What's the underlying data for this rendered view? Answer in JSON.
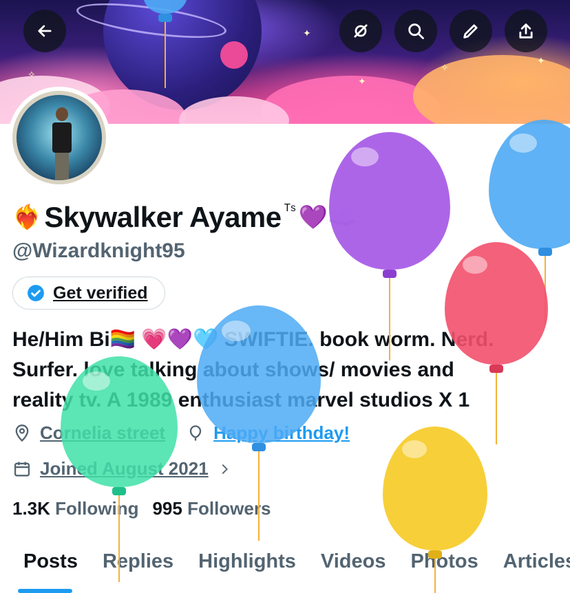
{
  "header": {
    "back_icon": "arrow-left-icon",
    "actions": [
      "grok-icon",
      "search-icon",
      "edit-icon",
      "share-icon"
    ]
  },
  "profile": {
    "name_emoji_left": "❤️‍🔥",
    "display_name": "Skywalker Ayame",
    "name_suffix": "ᵀˢ",
    "name_emoji_right": "💜☁️",
    "handle": "@Wizardknight95",
    "verify_button": "Get verified",
    "bio_lines": [
      "He/Him Bi🏳️‍🌈 💗💜🩵 SWIFTIE. book worm. Nerd.",
      "Surfer. love talking about shows/ movies and",
      "reality tv. A 1989 enthusiast marvel studios X 1"
    ],
    "location": "Cornelia street",
    "birthday": "Happy birthday!",
    "joined": "Joined August 2021",
    "following_count": "1.3K",
    "following_label": "Following",
    "followers_count": "995",
    "followers_label": "Followers"
  },
  "tabs": [
    "Posts",
    "Replies",
    "Highlights",
    "Videos",
    "Photos",
    "Articles"
  ],
  "colors": {
    "accent": "#1d9bf0",
    "text": "#0f1419",
    "muted": "#536471",
    "balloon_purple": "#a454e6",
    "balloon_blue": "#4eaaf4",
    "balloon_red": "#f2506c",
    "balloon_green": "#3fe0a8",
    "balloon_yellow": "#f7cc2e"
  }
}
